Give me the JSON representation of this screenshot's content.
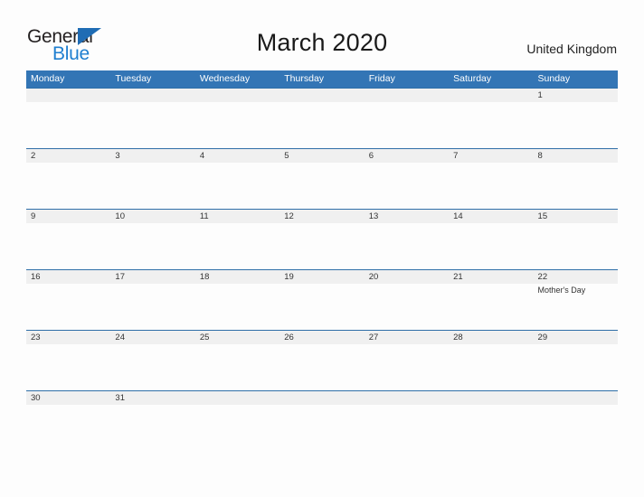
{
  "brand": {
    "word1": "General",
    "word2": "Blue",
    "flag_color": "#1f6cb4",
    "blue_text_color": "#1f7fd0"
  },
  "header": {
    "title": "March 2020",
    "country": "United Kingdom",
    "accent_color": "#3375b5"
  },
  "calendar": {
    "weekday_headers": [
      "Monday",
      "Tuesday",
      "Wednesday",
      "Thursday",
      "Friday",
      "Saturday",
      "Sunday"
    ],
    "weeks": [
      {
        "days": [
          {
            "num": "",
            "event": ""
          },
          {
            "num": "",
            "event": ""
          },
          {
            "num": "",
            "event": ""
          },
          {
            "num": "",
            "event": ""
          },
          {
            "num": "",
            "event": ""
          },
          {
            "num": "",
            "event": ""
          },
          {
            "num": "1",
            "event": ""
          }
        ]
      },
      {
        "days": [
          {
            "num": "2",
            "event": ""
          },
          {
            "num": "3",
            "event": ""
          },
          {
            "num": "4",
            "event": ""
          },
          {
            "num": "5",
            "event": ""
          },
          {
            "num": "6",
            "event": ""
          },
          {
            "num": "7",
            "event": ""
          },
          {
            "num": "8",
            "event": ""
          }
        ]
      },
      {
        "days": [
          {
            "num": "9",
            "event": ""
          },
          {
            "num": "10",
            "event": ""
          },
          {
            "num": "11",
            "event": ""
          },
          {
            "num": "12",
            "event": ""
          },
          {
            "num": "13",
            "event": ""
          },
          {
            "num": "14",
            "event": ""
          },
          {
            "num": "15",
            "event": ""
          }
        ]
      },
      {
        "days": [
          {
            "num": "16",
            "event": ""
          },
          {
            "num": "17",
            "event": ""
          },
          {
            "num": "18",
            "event": ""
          },
          {
            "num": "19",
            "event": ""
          },
          {
            "num": "20",
            "event": ""
          },
          {
            "num": "21",
            "event": ""
          },
          {
            "num": "22",
            "event": "Mother's Day"
          }
        ]
      },
      {
        "days": [
          {
            "num": "23",
            "event": ""
          },
          {
            "num": "24",
            "event": ""
          },
          {
            "num": "25",
            "event": ""
          },
          {
            "num": "26",
            "event": ""
          },
          {
            "num": "27",
            "event": ""
          },
          {
            "num": "28",
            "event": ""
          },
          {
            "num": "29",
            "event": ""
          }
        ]
      },
      {
        "days": [
          {
            "num": "30",
            "event": ""
          },
          {
            "num": "31",
            "event": ""
          },
          {
            "num": "",
            "event": ""
          },
          {
            "num": "",
            "event": ""
          },
          {
            "num": "",
            "event": ""
          },
          {
            "num": "",
            "event": ""
          },
          {
            "num": "",
            "event": ""
          }
        ]
      }
    ]
  }
}
